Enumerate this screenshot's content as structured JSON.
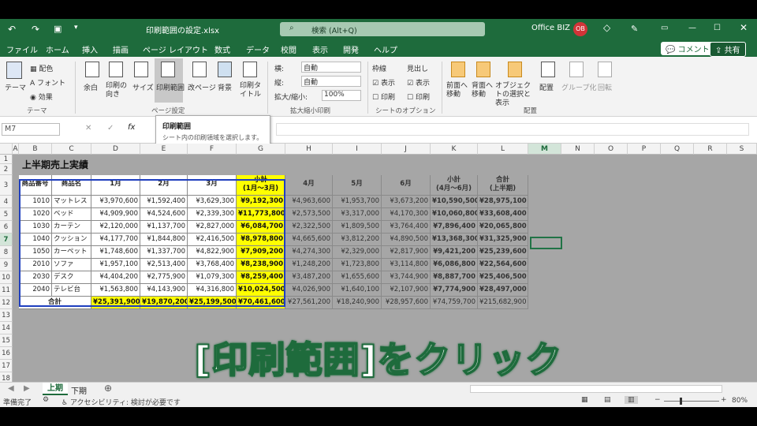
{
  "titlebar": {
    "filename": "印刷範囲の設定.xlsx",
    "search": "検索 (Alt+Q)",
    "account": "Office BIZ",
    "avatar": "OB"
  },
  "menu": {
    "tabs": [
      "ファイル",
      "ホーム",
      "挿入",
      "描画",
      "ページ レイアウト",
      "数式",
      "データ",
      "校閲",
      "表示",
      "開発",
      "ヘルプ"
    ],
    "active": "ページ レイアウト",
    "comment": "コメント",
    "share": "共有"
  },
  "ribbon": {
    "theme": {
      "label": "テーマ",
      "colors": "配色",
      "fonts": "フォント",
      "effects": "効果",
      "group": "テーマ"
    },
    "pagesetup": {
      "margins": "余白",
      "orientation": "印刷の向き",
      "size": "サイズ",
      "printarea": "印刷範囲",
      "breaks": "改ページ",
      "background": "背景",
      "titles": "印刷タイトル",
      "group": "ページ設定"
    },
    "scale": {
      "width_label": "横:",
      "width_val": "自動",
      "height_label": "縦:",
      "height_val": "自動",
      "scale_label": "拡大/縮小:",
      "scale_val": "100%",
      "group": "拡大縮小印刷"
    },
    "sheetopts": {
      "gridlines": "枠線",
      "headings": "見出し",
      "view": "表示",
      "print": "印刷",
      "group": "シートのオプション"
    },
    "arrange": {
      "forward": "前面へ移動",
      "backward": "背面へ移動",
      "pane": "オブジェクトの選択と表示",
      "align": "配置",
      "group_obj": "グループ化",
      "rotate": "回転",
      "group": "配置"
    }
  },
  "formula": {
    "namebox": "M7",
    "fx": "fx"
  },
  "tooltip": {
    "title": "印刷範囲",
    "desc": "シート内の印刷領域を選択します。"
  },
  "columns": [
    "A",
    "B",
    "C",
    "D",
    "E",
    "F",
    "G",
    "H",
    "I",
    "J",
    "K",
    "L",
    "M",
    "N",
    "O",
    "P",
    "Q",
    "R",
    "S"
  ],
  "sheet": {
    "title": "上半期売上実績",
    "headers": [
      "商品番号",
      "商品名",
      "1月",
      "2月",
      "3月",
      "小計",
      "4月",
      "5月",
      "6月",
      "小計",
      "合計"
    ],
    "subheaders": {
      "q1": "(1月～3月)",
      "q2": "(4月～6月)",
      "total": "(上半期)"
    },
    "rows": [
      [
        "1010",
        "マットレス",
        "¥3,970,600",
        "¥1,592,400",
        "¥3,629,300",
        "¥9,192,300",
        "¥4,963,600",
        "¥1,953,700",
        "¥3,673,200",
        "¥10,590,500",
        "¥28,975,100"
      ],
      [
        "1020",
        "ベッド",
        "¥4,909,900",
        "¥4,524,600",
        "¥2,339,300",
        "¥11,773,800",
        "¥2,573,500",
        "¥3,317,000",
        "¥4,170,300",
        "¥10,060,800",
        "¥33,608,400"
      ],
      [
        "1030",
        "カーテン",
        "¥2,120,000",
        "¥1,137,700",
        "¥2,827,000",
        "¥6,084,700",
        "¥2,322,500",
        "¥1,809,500",
        "¥3,764,400",
        "¥7,896,400",
        "¥20,065,800"
      ],
      [
        "1040",
        "クッション",
        "¥4,177,700",
        "¥1,844,800",
        "¥2,416,500",
        "¥8,978,800",
        "¥4,665,600",
        "¥3,812,200",
        "¥4,890,500",
        "¥13,368,300",
        "¥31,325,900"
      ],
      [
        "1050",
        "カーペット",
        "¥1,748,600",
        "¥1,337,700",
        "¥4,822,900",
        "¥7,909,200",
        "¥4,274,300",
        "¥2,329,000",
        "¥2,817,900",
        "¥9,421,200",
        "¥25,239,600"
      ],
      [
        "2010",
        "ソファ",
        "¥1,957,100",
        "¥2,513,400",
        "¥3,768,400",
        "¥8,238,900",
        "¥1,248,200",
        "¥1,723,800",
        "¥3,114,800",
        "¥6,086,800",
        "¥22,564,600"
      ],
      [
        "2030",
        "デスク",
        "¥4,404,200",
        "¥2,775,900",
        "¥1,079,300",
        "¥8,259,400",
        "¥3,487,200",
        "¥1,655,600",
        "¥3,744,900",
        "¥8,887,700",
        "¥25,406,500"
      ],
      [
        "2040",
        "テレビ台",
        "¥1,563,800",
        "¥4,143,900",
        "¥4,316,800",
        "¥10,024,500",
        "¥4,026,900",
        "¥1,640,100",
        "¥2,107,900",
        "¥7,774,900",
        "¥28,497,000"
      ]
    ],
    "total": [
      "合計",
      "¥25,391,900",
      "¥19,870,200",
      "¥25,199,500",
      "¥70,461,600",
      "¥27,561,200",
      "¥18,240,900",
      "¥28,957,600",
      "¥74,759,700",
      "¥215,682,900"
    ]
  },
  "caption": "[印刷範囲]をクリック",
  "tabs": {
    "first": "上期",
    "second": "下期"
  },
  "status": {
    "ready": "準備完了",
    "access": "アクセシビリティ: 検討が必要です",
    "zoom": "80%"
  },
  "colors": {
    "excel_green": "#1e6b3c",
    "highlight": "#ffff00",
    "header_border": "#1f3fbf"
  }
}
